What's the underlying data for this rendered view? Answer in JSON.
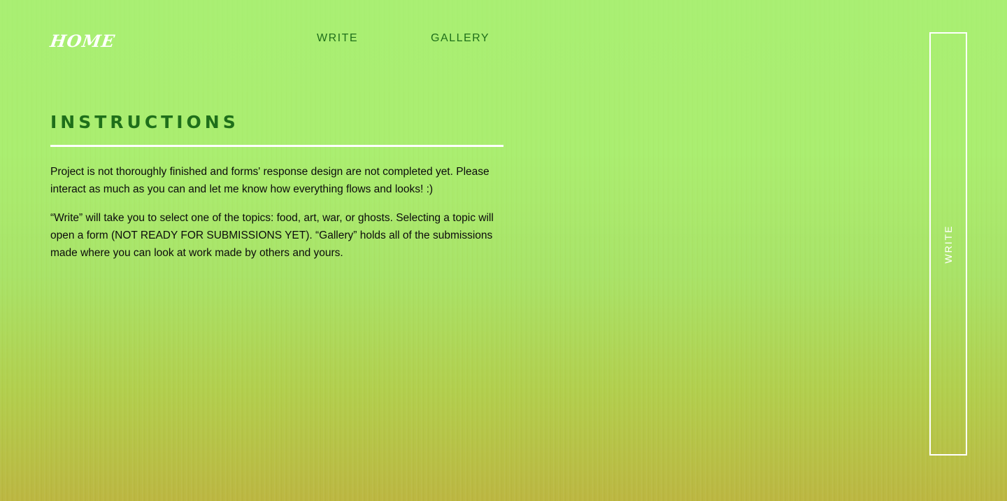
{
  "header": {
    "logo": "HOME",
    "nav": [
      {
        "label": "WRITE"
      },
      {
        "label": "GALLERY"
      }
    ]
  },
  "instructions": {
    "title": "INSTRUCTIONS",
    "paragraphs": [
      "Project is not thoroughly finished and forms' response design are not completed yet. Please interact as much as you can and let me know how everything flows and looks! :)",
      "“Write” will take you to select one of the topics: food, art, war, or ghosts. Selecting a topic will open a form (NOT READY FOR SUBMISSIONS YET). “Gallery” holds all of the submissions made where you can look at work made by others and yours."
    ]
  },
  "side_panel": {
    "label": "WRITE"
  },
  "colors": {
    "accent_green": "#1f6f1a",
    "background_top": "#a9ef73",
    "background_bottom": "#bcb742",
    "white": "#ffffff"
  }
}
